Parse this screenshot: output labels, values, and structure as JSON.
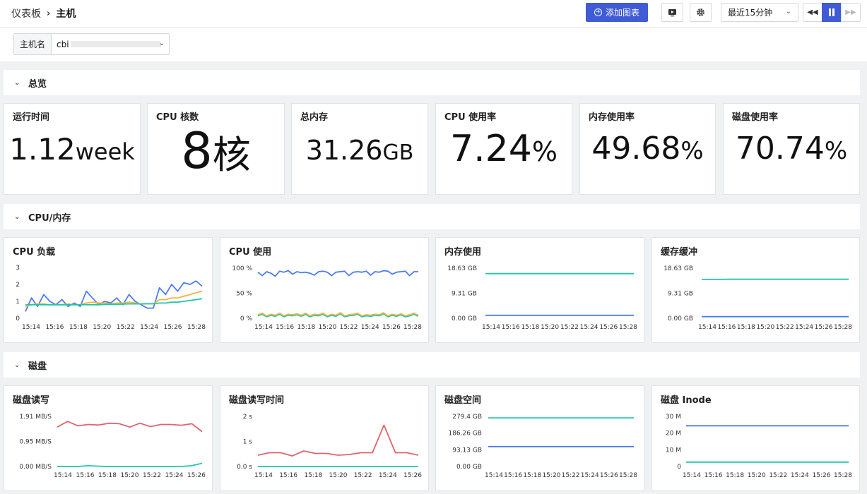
{
  "breadcrumb": {
    "root": "仪表板",
    "current": "主机"
  },
  "toolbar": {
    "add_chart": "添加图表",
    "time_range": "最近15分钟"
  },
  "filter": {
    "label": "主机名",
    "value": "cbi"
  },
  "sections": {
    "overview": "总览",
    "cpu_mem": "CPU/内存",
    "disk": "磁盘"
  },
  "stats": [
    {
      "label": "运行时间",
      "value": "1.12",
      "unit": "week"
    },
    {
      "label": "CPU 核数",
      "value": "8",
      "unit": "核"
    },
    {
      "label": "总内存",
      "value": "31.26",
      "unit": "GB"
    },
    {
      "label": "CPU 使用率",
      "value": "7.24",
      "unit": "%"
    },
    {
      "label": "内存使用率",
      "value": "49.68",
      "unit": "%"
    },
    {
      "label": "磁盘使用率",
      "value": "70.74",
      "unit": "%"
    }
  ],
  "colors": {
    "blue": "#4d7cf0",
    "green": "#1dc9a7",
    "orange": "#f5b342",
    "red": "#e0636e",
    "accent": "#3f5bd5"
  },
  "chart_data": [
    {
      "id": "cpu_load",
      "type": "line",
      "title": "CPU 负载",
      "ylim": [
        0,
        3
      ],
      "yticks": [
        "0",
        "1",
        "2",
        "3"
      ],
      "xticks": [
        "15:14",
        "15:16",
        "15:18",
        "15:20",
        "15:22",
        "15:24",
        "15:26",
        "15:28"
      ],
      "series": [
        {
          "color": "#4d7cf0",
          "values": [
            0.4,
            1.2,
            0.7,
            1.4,
            1.0,
            0.8,
            1.1,
            0.7,
            0.9,
            0.7,
            1.6,
            1.2,
            0.8,
            1.0,
            0.9,
            1.2,
            0.8,
            1.4,
            1.0,
            0.8,
            0.6,
            0.6,
            1.8,
            1.4,
            2.0,
            1.6,
            2.1,
            2.0,
            2.2,
            1.9
          ]
        },
        {
          "color": "#f5b342",
          "values": [
            0.7,
            0.8,
            0.85,
            0.85,
            0.8,
            0.8,
            0.8,
            0.85,
            0.8,
            0.8,
            0.9,
            0.95,
            0.9,
            0.9,
            0.85,
            0.9,
            0.9,
            0.95,
            0.9,
            0.85,
            0.85,
            0.85,
            1.1,
            1.1,
            1.2,
            1.2,
            1.3,
            1.4,
            1.5,
            1.6
          ]
        },
        {
          "color": "#1dc9a7",
          "values": [
            0.8,
            0.8,
            0.8,
            0.8,
            0.8,
            0.8,
            0.8,
            0.8,
            0.8,
            0.8,
            0.8,
            0.8,
            0.8,
            0.82,
            0.82,
            0.82,
            0.84,
            0.85,
            0.85,
            0.85,
            0.86,
            0.86,
            0.9,
            0.9,
            0.95,
            0.95,
            1.0,
            1.05,
            1.1,
            1.15
          ]
        }
      ]
    },
    {
      "id": "cpu_usage",
      "type": "line",
      "title": "CPU 使用",
      "ylim": [
        0,
        100
      ],
      "yticks": [
        "0 %",
        "50 %",
        "100 %"
      ],
      "xticks": [
        "15:14",
        "15:16",
        "15:18",
        "15:20",
        "15:22",
        "15:24",
        "15:26",
        "15:28"
      ],
      "series": [
        {
          "color": "#4d7cf0",
          "values": [
            92,
            85,
            93,
            90,
            84,
            94,
            92,
            95,
            88,
            93,
            91,
            92,
            90,
            86,
            93,
            94,
            92,
            85,
            92,
            93,
            94,
            85,
            92,
            93,
            92,
            94,
            86,
            93,
            92,
            95,
            94,
            88,
            92,
            93,
            94,
            85,
            93,
            93
          ]
        },
        {
          "color": "#1dc9a7",
          "values": [
            5,
            8,
            3,
            6,
            4,
            8,
            3,
            6,
            5,
            7,
            4,
            8,
            3,
            6,
            5,
            8,
            3,
            6,
            4,
            9,
            3,
            5,
            6,
            8,
            3,
            5,
            4,
            6,
            5,
            9,
            3,
            6,
            4,
            7,
            3,
            5,
            8,
            4
          ]
        },
        {
          "color": "#f5b342",
          "values": [
            7,
            10,
            5,
            8,
            6,
            10,
            5,
            8,
            7,
            9,
            6,
            10,
            5,
            8,
            7,
            10,
            5,
            8,
            6,
            11,
            5,
            7,
            8,
            10,
            5,
            7,
            6,
            8,
            7,
            11,
            5,
            8,
            6,
            9,
            5,
            7,
            10,
            6
          ]
        }
      ]
    },
    {
      "id": "mem_usage",
      "type": "line",
      "title": "内存使用",
      "ylim": [
        0,
        18.63
      ],
      "yticks": [
        "0.00 GB",
        "9.31 GB",
        "18.63 GB"
      ],
      "xticks": [
        "15:14",
        "15:16",
        "15:18",
        "15:20",
        "15:22",
        "15:24",
        "15:26",
        "15:28"
      ],
      "series": [
        {
          "color": "#1dc9a7",
          "values": [
            16.6,
            16.6,
            16.6,
            16.6,
            16.6,
            16.6
          ]
        },
        {
          "color": "#4d7cf0",
          "values": [
            1.1,
            1.1,
            1.1,
            1.1,
            1.1,
            1.1
          ]
        }
      ]
    },
    {
      "id": "cache_buffer",
      "type": "line",
      "title": "缓存缓冲",
      "ylim": [
        0,
        18.63
      ],
      "yticks": [
        "0.00 GB",
        "9.31 GB",
        "18.63 GB"
      ],
      "xticks": [
        "15:14",
        "15:16",
        "15:18",
        "15:20",
        "15:22",
        "15:24",
        "15:26",
        "15:28"
      ],
      "series": [
        {
          "color": "#1dc9a7",
          "values": [
            14.4,
            14.5,
            14.5,
            14.5,
            14.5,
            14.5
          ]
        },
        {
          "color": "#4d7cf0",
          "values": [
            0.6,
            0.6,
            0.6,
            0.6,
            0.6,
            0.6
          ]
        }
      ]
    },
    {
      "id": "disk_rw",
      "type": "line",
      "title": "磁盘读写",
      "ylim": [
        0,
        1.91
      ],
      "yticks": [
        "0.00 MB/S",
        "0.95 MB/S",
        "1.91 MB/S"
      ],
      "xticks": [
        "15:14",
        "15:16",
        "15:18",
        "15:20",
        "15:22",
        "15:24",
        "15:26"
      ],
      "series": [
        {
          "color": "#e0636e",
          "values": [
            1.5,
            1.72,
            1.55,
            1.6,
            1.58,
            1.65,
            1.63,
            1.5,
            1.65,
            1.52,
            1.6,
            1.6,
            1.57,
            1.63,
            1.33
          ]
        },
        {
          "color": "#1dc9a7",
          "values": [
            0.0,
            0.0,
            0.0,
            0.03,
            0.01,
            0.0,
            0.0,
            0.0,
            0.0,
            0.0,
            0.0,
            0.0,
            0.0,
            0.03,
            0.12
          ]
        }
      ]
    },
    {
      "id": "disk_rw_time",
      "type": "line",
      "title": "磁盘读写时间",
      "ylim": [
        0,
        2
      ],
      "yticks": [
        "0.0 s",
        "1 s",
        "2 s"
      ],
      "xticks": [
        "15:14",
        "15:16",
        "15:18",
        "15:20",
        "15:22",
        "15:24",
        "15:26"
      ],
      "series": [
        {
          "color": "#e0636e",
          "values": [
            0.45,
            0.55,
            0.55,
            0.42,
            0.62,
            0.52,
            0.52,
            0.45,
            0.48,
            0.55,
            0.55,
            1.65,
            0.55,
            0.55,
            0.45
          ]
        },
        {
          "color": "#1dc9a7",
          "values": [
            0.0,
            0.0,
            0.0,
            0.0,
            0.0,
            0.0,
            0.0,
            0.0,
            0.0,
            0.0,
            0.0,
            0.0,
            0.0,
            0.0,
            0.0
          ]
        }
      ]
    },
    {
      "id": "disk_space",
      "type": "line",
      "title": "磁盘空间",
      "ylim": [
        0,
        279.4
      ],
      "yticks": [
        "0.00 GB",
        "93.13 GB",
        "186.26 GB",
        "279.4 GB"
      ],
      "xticks": [
        "15:14",
        "15:16",
        "15:18",
        "15:20",
        "15:22",
        "15:24",
        "15:26",
        "15:28"
      ],
      "series": [
        {
          "color": "#1dc9a7",
          "values": [
            271,
            271,
            271,
            271,
            271,
            271
          ]
        },
        {
          "color": "#4d7cf0",
          "values": [
            111,
            111,
            111,
            111,
            111,
            111
          ]
        }
      ]
    },
    {
      "id": "disk_inode",
      "type": "line",
      "title": "磁盘 Inode",
      "ylim": [
        0,
        30
      ],
      "yticks": [
        "0",
        "10 M",
        "20 M",
        "30 M"
      ],
      "xticks": [
        "15:14",
        "15:16",
        "15:18",
        "15:20",
        "15:22",
        "15:24",
        "15:26",
        "15:28"
      ],
      "series": [
        {
          "color": "#4d7cf0",
          "values": [
            24.4,
            24.4,
            24.4,
            24.4,
            24.4,
            24.4
          ]
        },
        {
          "color": "#1dc9a7",
          "values": [
            2.6,
            2.6,
            2.6,
            2.6,
            2.6,
            2.6
          ]
        }
      ]
    }
  ]
}
